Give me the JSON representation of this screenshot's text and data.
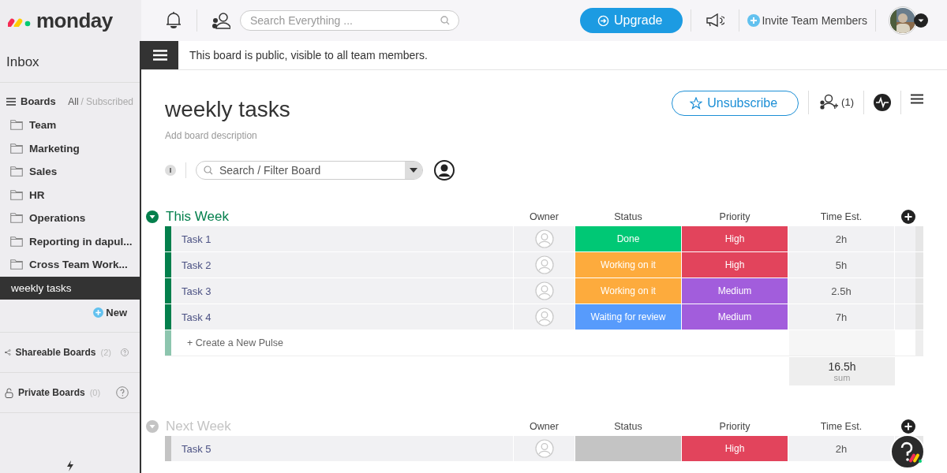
{
  "brand": {
    "name": "monday"
  },
  "topbar": {
    "search_placeholder": "Search Everything ...",
    "upgrade": "Upgrade",
    "invite": "Invite Team Members"
  },
  "sidebar": {
    "inbox": "Inbox",
    "boards_title": "Boards",
    "filter_all": "All",
    "filter_sep": "/",
    "filter_subscribed": "Subscribed",
    "items": [
      {
        "label": "Team",
        "kind": "folder",
        "selected": false
      },
      {
        "label": "Marketing",
        "kind": "folder",
        "selected": false
      },
      {
        "label": "Sales",
        "kind": "folder",
        "selected": false
      },
      {
        "label": "HR",
        "kind": "folder",
        "selected": false
      },
      {
        "label": "Operations",
        "kind": "folder",
        "selected": false
      },
      {
        "label": "Reporting in dapul...",
        "kind": "folder",
        "selected": false
      },
      {
        "label": "Cross Team Work...",
        "kind": "folder",
        "selected": false
      },
      {
        "label": "weekly tasks",
        "kind": "board",
        "selected": true
      }
    ],
    "new": "New",
    "sections": [
      {
        "label": "Shareable Boards",
        "count": "(2)",
        "kind": "share"
      },
      {
        "label": "Private Boards",
        "count": "(0)",
        "kind": "lock"
      }
    ]
  },
  "banner": "This board is public, visible to all team members.",
  "board": {
    "title": "weekly tasks",
    "description": "Add board description",
    "unsubscribe": "Unsubscribe",
    "members": "(1)",
    "filter_placeholder": "Search / Filter Board"
  },
  "groups": [
    {
      "name": "This Week",
      "color": "#037f4c",
      "columns": [
        "Owner",
        "Status",
        "Priority",
        "Time Est."
      ],
      "rows": [
        {
          "name": "Task 1",
          "status": {
            "label": "Done",
            "color": "#00c875"
          },
          "priority": {
            "label": "High",
            "color": "#e2445c"
          },
          "time": "2h"
        },
        {
          "name": "Task 2",
          "status": {
            "label": "Working on it",
            "color": "#fdab3d"
          },
          "priority": {
            "label": "High",
            "color": "#e2445c"
          },
          "time": "5h"
        },
        {
          "name": "Task 3",
          "status": {
            "label": "Working on it",
            "color": "#fdab3d"
          },
          "priority": {
            "label": "Medium",
            "color": "#a25ddc"
          },
          "time": "2.5h"
        },
        {
          "name": "Task 4",
          "status": {
            "label": "Waiting for review",
            "color": "#579bfc"
          },
          "priority": {
            "label": "Medium",
            "color": "#a25ddc"
          },
          "time": "7h"
        }
      ],
      "new_row": "+ Create a New Pulse",
      "sum": "16.5h",
      "sum_label": "sum"
    },
    {
      "name": "Next Week",
      "color": "#c4c4c4",
      "columns": [
        "Owner",
        "Status",
        "Priority",
        "Time Est."
      ],
      "rows": [
        {
          "name": "Task 5",
          "status": {
            "color": "#c4c4c4"
          },
          "priority": {
            "label": "High",
            "color": "#e2445c"
          },
          "time": "2h"
        }
      ]
    }
  ]
}
